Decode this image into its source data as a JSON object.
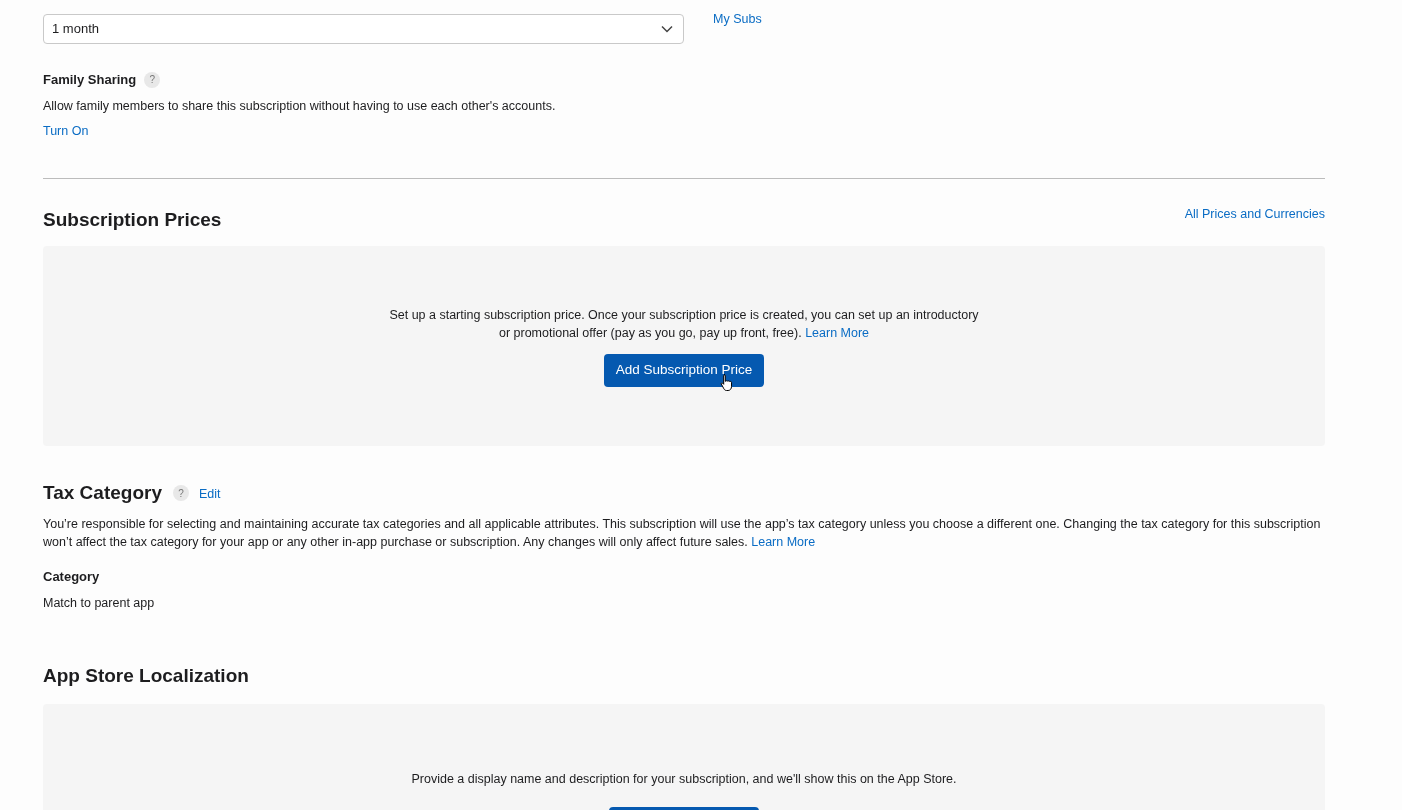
{
  "duration": {
    "value": "1 month"
  },
  "side_link": "My Subs",
  "family_sharing": {
    "label": "Family Sharing",
    "help": "?",
    "description": "Allow family members to share this subscription without having to use each other's accounts.",
    "action": "Turn On"
  },
  "subscription_prices": {
    "title": "Subscription Prices",
    "link": "All Prices and Currencies",
    "text": "Set up a starting subscription price. Once your subscription price is created, you can set up an introductory or promotional offer (pay as you go, pay up front, free).",
    "text_link": "Learn More",
    "button": "Add Subscription Price"
  },
  "tax_category": {
    "title": "Tax Category",
    "help": "?",
    "edit": "Edit",
    "text": "You’re responsible for selecting and maintaining accurate tax categories and all applicable attributes. This subscription will use the app’s tax category unless you choose a different one. Changing the tax category for this subscription won’t affect the tax category for your app or any other in-app purchase or subscription. Any changes will only affect future sales.",
    "text_link": "Learn More",
    "category_label": "Category",
    "category_value": "Match to parent app"
  },
  "localization": {
    "title": "App Store Localization",
    "text": "Provide a display name and description for your subscription, and we'll show this on the App Store."
  }
}
